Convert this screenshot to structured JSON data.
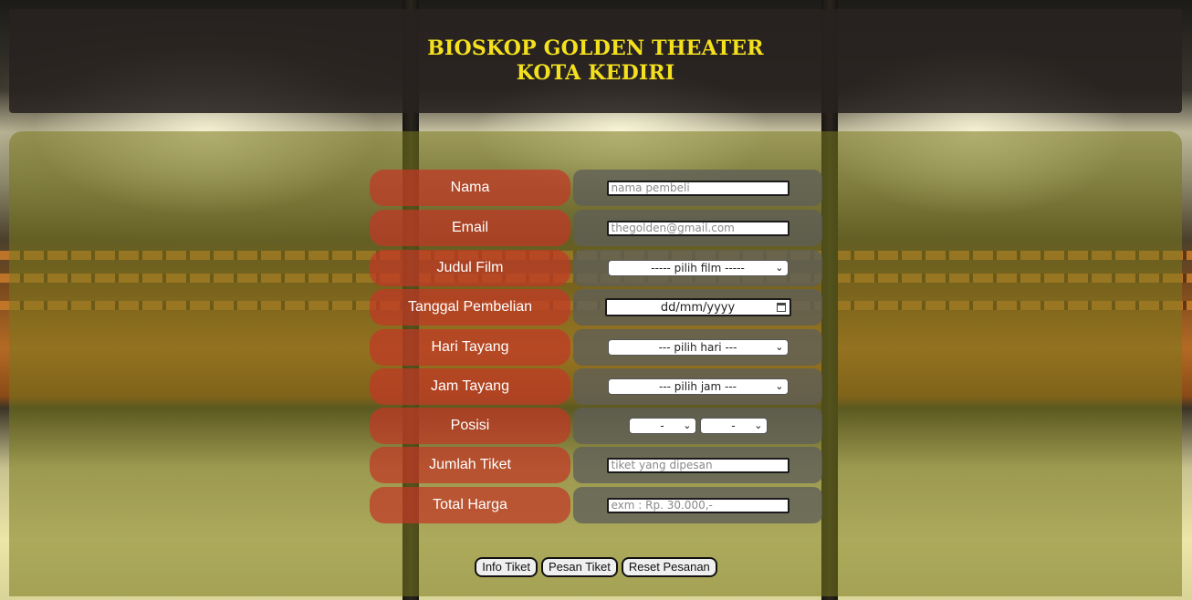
{
  "header": {
    "title_line1": "BIOSKOP GOLDEN THEATER",
    "title_line2": "KOTA KEDIRI",
    "title_color": "#f4e01e"
  },
  "form": {
    "nama": {
      "label": "Nama",
      "placeholder": "nama pembeli"
    },
    "email": {
      "label": "Email",
      "placeholder": "thegolden@gmail.com"
    },
    "judul_film": {
      "label": "Judul Film",
      "selected": "----- pilih film -----"
    },
    "tanggal": {
      "label": "Tanggal Pembelian",
      "value": "dd/mm/yyyy",
      "icon": "calendar-icon"
    },
    "hari": {
      "label": "Hari Tayang",
      "selected": "--- pilih hari ---"
    },
    "jam": {
      "label": "Jam Tayang",
      "selected": "--- pilih jam ---"
    },
    "posisi": {
      "label": "Posisi",
      "row_selected": "-",
      "seat_selected": "-"
    },
    "jumlah": {
      "label": "Jumlah Tiket",
      "placeholder": "tiket yang dipesan"
    },
    "total": {
      "label": "Total Harga",
      "placeholder": "exm : Rp. 30.000,-"
    }
  },
  "buttons": {
    "info": "Info Tiket",
    "pesan": "Pesan Tiket",
    "reset": "Reset Pesanan"
  },
  "colors": {
    "label_bg": "#c23826",
    "field_bg": "#5f5f58",
    "main_overlay": "#78781e"
  }
}
